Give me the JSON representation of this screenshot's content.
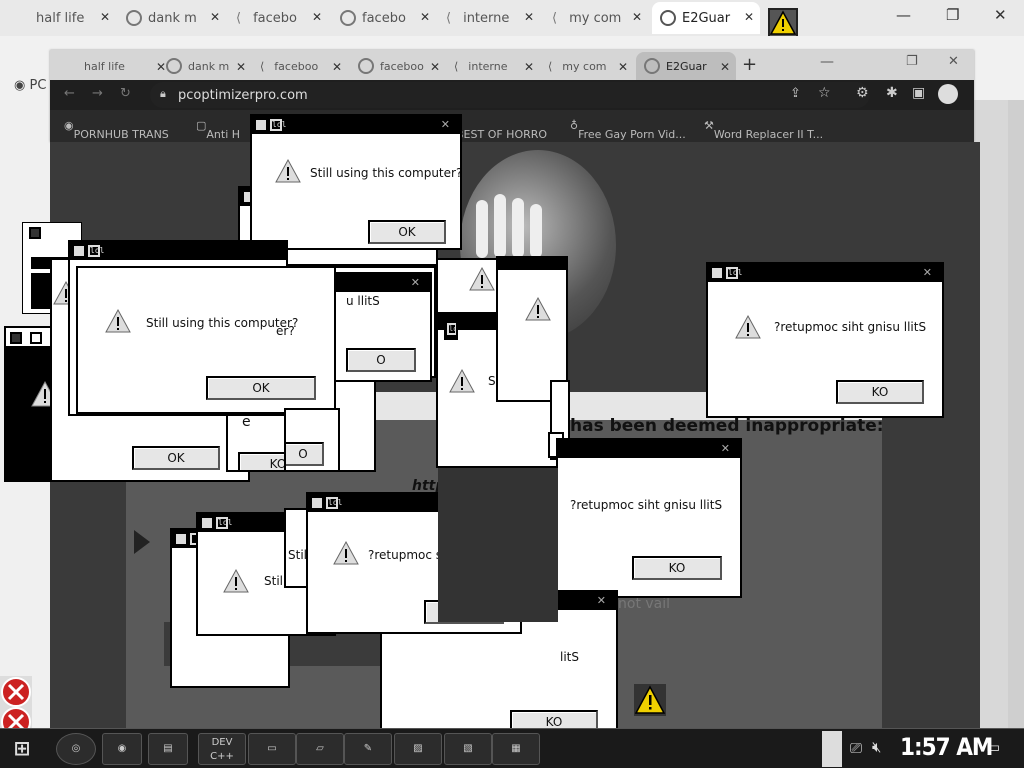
{
  "browser_tabs": [
    {
      "label": "half life",
      "active": false
    },
    {
      "label": "dank m",
      "active": false
    },
    {
      "label": "facebo",
      "active": false
    },
    {
      "label": "facebo",
      "active": false
    },
    {
      "label": "interne",
      "active": false
    },
    {
      "label": "my com",
      "active": false
    },
    {
      "label": "E2Guar",
      "active": true
    }
  ],
  "inner_tabs": [
    {
      "label": "half life"
    },
    {
      "label": "dank m"
    },
    {
      "label": "faceboo"
    },
    {
      "label": "faceboo"
    },
    {
      "label": "interne"
    },
    {
      "label": "my com"
    },
    {
      "label": "E2Guar"
    }
  ],
  "address": "pcoptimizerpro.com",
  "outer_bookmark": "PC",
  "bookmarks": [
    "PORNHUB TRANS",
    "Anti H",
    "BEST OF HORRO",
    "Free Gay Porn Vid...",
    "Word Replacer II T..."
  ],
  "page": {
    "heading": "has been deemed inappropriate:",
    "fragment_link": "http",
    "fragment_bottom": "not vail",
    "fragment_e": "e"
  },
  "dialog": {
    "message": "Still using this computer?",
    "message_reversed": "?retupmoc siht gnisu llitS",
    "ok": "OK",
    "ok_reversed": "KO",
    "fragment_er": "er?",
    "fragment_s": "S",
    "fragment_stil": "Stil",
    "fragment_still": "Stil",
    "fragment_litS": "llitS",
    "fragment_litS2": "litS",
    "fragment_u_llits": "u llitS",
    "fragment_ko": "KO",
    "fragment_o": "O",
    "fragment_ok_short": "o",
    "title_icon": "lol"
  },
  "taskbar": {
    "items": [
      "chrome",
      "firefox",
      "save",
      "DEV C++",
      "terminal",
      "notes",
      "paint",
      "photos",
      "gallery",
      "images"
    ],
    "devcpp_label": "DEV C++",
    "time": "1:57 AM"
  }
}
